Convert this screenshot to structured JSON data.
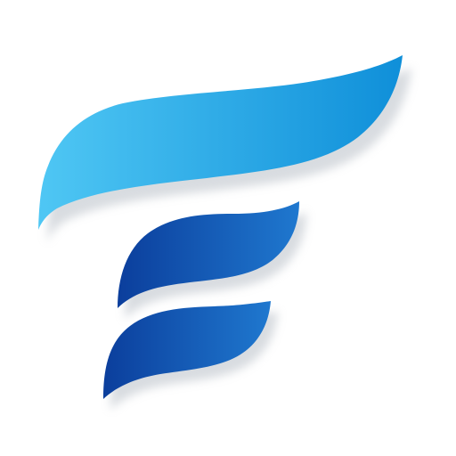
{
  "image": {
    "background_color": "#ffffff",
    "logo": {
      "icon": "stylized-letter-f-wave-icon",
      "colors": {
        "top_stroke_start": "#4fc7f4",
        "top_stroke_end": "#0f8fd9",
        "middle_stroke_start": "#0b3e9c",
        "middle_stroke_end": "#1f78cf",
        "bottom_stroke_start": "#0b3e9c",
        "bottom_stroke_end": "#1f78cf",
        "shadow": "#b9c0c8"
      }
    }
  }
}
